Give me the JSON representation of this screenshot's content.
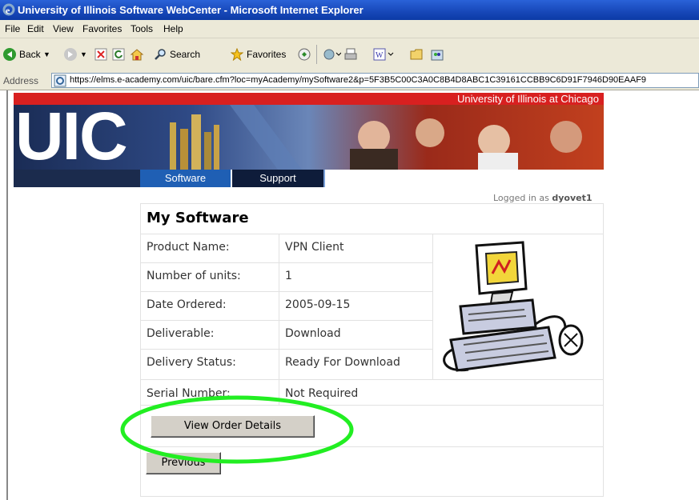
{
  "window": {
    "title": "University of Illinois Software WebCenter - Microsoft Internet Explorer"
  },
  "menu": [
    "File",
    "Edit",
    "View",
    "Favorites",
    "Tools",
    "Help"
  ],
  "toolbar": {
    "back": "Back",
    "search": "Search",
    "favorites": "Favorites"
  },
  "address": {
    "label": "Address",
    "url": "https://elms.e-academy.com/uic/bare.cfm?loc=myAcademy/mySoftware2&p=5F3B5C00C3A0C8B4D8ABC1C39161CCBB9C6D91F7946D90EAAF9"
  },
  "banner": {
    "university": "University of Illinois at Chicago",
    "logo": "UIC"
  },
  "nav": {
    "software": "Software",
    "support": "Support"
  },
  "login": {
    "prefix": "Logged in as",
    "user": "dyovet1"
  },
  "page": {
    "title": "My Software",
    "rows": [
      {
        "label": "Product Name:",
        "value": "VPN Client"
      },
      {
        "label": "Number of units:",
        "value": "1"
      },
      {
        "label": "Date Ordered:",
        "value": "2005-09-15"
      },
      {
        "label": "Deliverable:",
        "value": "Download"
      },
      {
        "label": "Delivery Status:",
        "value": "Ready For Download"
      },
      {
        "label": "Serial Number:",
        "value": "Not Required"
      }
    ],
    "view_order_button": "View Order Details",
    "previous_button": "Previous"
  },
  "colors": {
    "highlight_ellipse": "#22ee22",
    "banner_red": "#d82020",
    "banner_navy": "#1b2b4d"
  },
  "icons": [
    "ie-logo-icon",
    "back-arrow-icon",
    "forward-arrow-icon",
    "stop-icon",
    "refresh-icon",
    "home-icon",
    "search-icon",
    "favorites-star-icon",
    "media-icon",
    "mail-icon",
    "print-icon",
    "edit-icon",
    "folder-icon",
    "messenger-icon",
    "computer-clipart-icon"
  ]
}
